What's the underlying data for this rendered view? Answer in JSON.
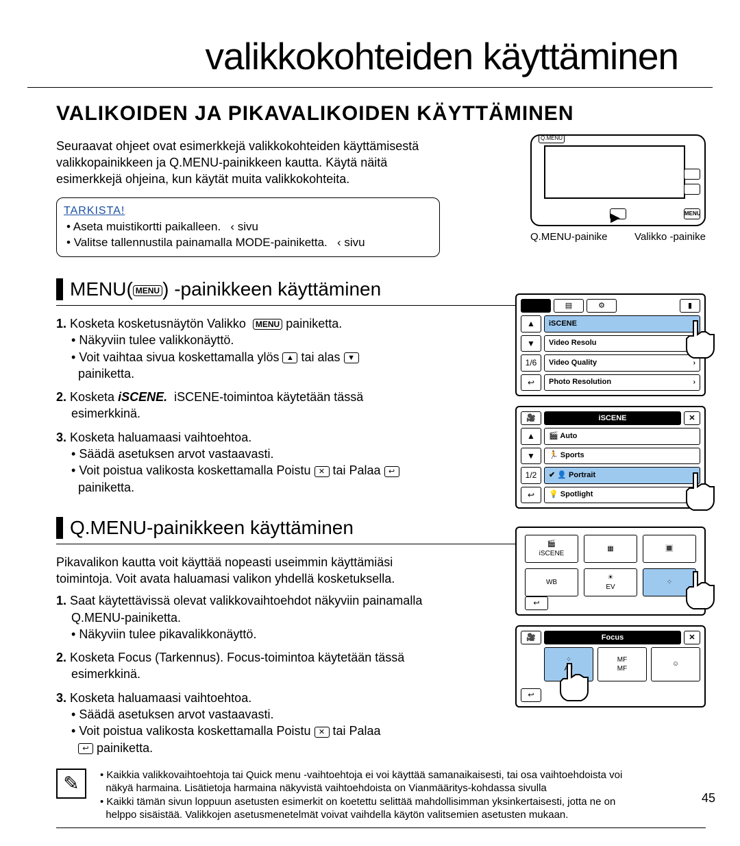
{
  "page_title": "valikkokohteiden käyttäminen",
  "section_title": "VALIKOIDEN JA PIKAVALIKOIDEN KÄYTTÄMINEN",
  "intro_1": "Seuraavat ohjeet ovat esimerkkejä valikkokohteiden käyttämisestä",
  "intro_2": "valikkopainikkeen ja Q.MENU-painikkeen kautta. Käytä näitä",
  "intro_3": "esimerkkejä ohjeina, kun käytät muita valikkokohteita.",
  "check_title": "TARKISTA!",
  "check_item_1_a": "Aseta muistikortti paikalleen.",
  "check_item_1_b": "‹ sivu",
  "check_item_2_a": "Valitse tallennustila painamalla MODE-painiketta.",
  "check_item_2_b": "‹ sivu",
  "subsec1_prefix": "MENU(",
  "subsec1_suffix": ") -painikkeen käyttäminen",
  "menu_chip": "MENU",
  "s1_1a": "Kosketa kosketusnäytön Valikko",
  "s1_1b": " painiketta.",
  "s1_1c": "Näkyviin tulee valikkonäyttö.",
  "s1_1d": "Voit vaihtaa sivua koskettamalla ylös ",
  "s1_1e": " tai alas ",
  "s1_1f": "painiketta.",
  "s1_2a": "Kosketa ",
  "s1_2b": "iSCENE.",
  "s1_2c": "iSCENE-toimintoa käytetään tässä",
  "s1_2d": "esimerkkinä.",
  "s1_3a": "Kosketa haluamaasi vaihtoehtoa.",
  "s1_3b": "Säädä asetuksen arvot vastaavasti.",
  "s1_3c": "Voit poistua valikosta koskettamalla Poistu ",
  "s1_3d": " tai Palaa ",
  "s1_3e": "painiketta.",
  "subsec2": "Q.MENU-painikkeen käyttäminen",
  "s2_intro1": "Pikavalikon kautta voit käyttää nopeasti useimmin käyttämiäsi",
  "s2_intro2": "toimintoja. Voit avata haluamasi valikon yhdellä kosketuksella.",
  "s2_1a": "Saat käytettävissä olevat valikkovaihtoehdot näkyviin painamalla",
  "s2_1b": "Q.MENU-painiketta.",
  "s2_1c": "Näkyviin tulee pikavalikkonäyttö.",
  "s2_2a": "Kosketa Focus (Tarkennus). Focus-toimintoa käytetään tässä",
  "s2_2b": "esimerkkinä.",
  "s2_3a": "Kosketa haluamaasi vaihtoehtoa.",
  "s2_3b": "Säädä asetuksen arvot vastaavasti.",
  "s2_3c": "Voit poistua valikosta koskettamalla Poistu ",
  "s2_3d": " tai Palaa ",
  "s2_3e": " painiketta.",
  "cam_label_left": "Q.MENU-painike",
  "cam_label_right": "Valikko -painike",
  "cam_menu_btn": "MENU",
  "cam_qmenu": "Q.MENU",
  "menu1": {
    "r1": "iSCENE",
    "r2": "Video Resolu",
    "r3": "Video Quality",
    "r4": "Photo Resolution",
    "page": "1/6"
  },
  "menu2": {
    "title": "iSCENE",
    "r1": "Auto",
    "r2": "Sports",
    "r3": "Portrait",
    "r4": "Spotlight",
    "page": "1/2"
  },
  "qmenu": {
    "c1": "iSCENE",
    "c5": "EV"
  },
  "focus": {
    "title": "Focus",
    "f1": "AF",
    "f2": "MF"
  },
  "note_1": "Kaikkia valikkovaihtoehtoja tai Quick menu -vaihtoehtoja ei voi käyttää samanaikaisesti, tai osa vaihtoehdoista voi",
  "note_2": "näkyä harmaina. Lisätietoja harmaina näkyvistä vaihtoehdoista on Vianmääritys-kohdassa sivulla",
  "note_3": "Kaikki tämän sivun loppuun asetusten esimerkit on koetettu selittää mahdollisimman yksinkertaisesti, jotta ne on",
  "note_4": "helppo sisäistää. Valikkojen asetusmenetelmät voivat vaihdella käytön valitsemien asetusten mukaan.",
  "page_num": "45",
  "icons": {
    "up": "▲",
    "down": "▼",
    "close": "✕",
    "back": "↩",
    "right": "›",
    "bullet": "•",
    "cam": "🎥"
  }
}
